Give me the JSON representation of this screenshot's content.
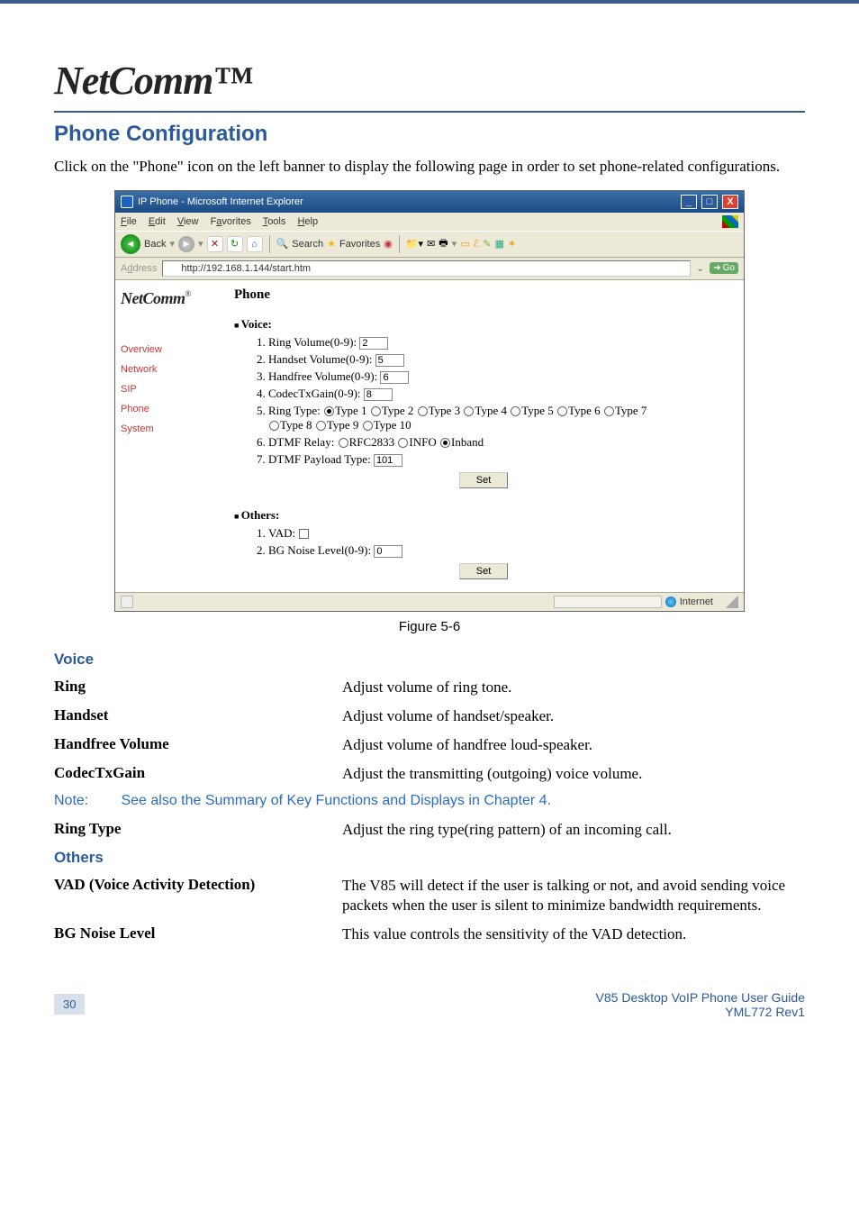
{
  "logo_text": "NetComm",
  "logo_tm": "™",
  "heading": "Phone Configuration",
  "intro": "Click on the \"Phone\" icon on the left banner to display the following page in order to set phone-related configurations.",
  "figure_caption": "Figure 5-6",
  "voice_heading": "Voice",
  "voice_items": [
    {
      "term": "Ring",
      "desc": "Adjust volume of ring tone."
    },
    {
      "term": "Handset",
      "desc": "Adjust volume of handset/speaker."
    },
    {
      "term": "Handfree Volume",
      "desc": "Adjust volume of handfree loud-speaker."
    },
    {
      "term": "CodecTxGain",
      "desc": "Adjust the transmitting (outgoing) voice volume."
    }
  ],
  "note_label": "Note:",
  "note_text": "See also the Summary of Key Functions and Displays in Chapter 4.",
  "ring_type": {
    "term": "Ring Type",
    "desc": "Adjust the ring type(ring pattern) of an incoming call."
  },
  "others_heading": "Others",
  "others_items": [
    {
      "term": "VAD (Voice Activity Detection)",
      "desc": "The V85 will detect if the user is talking or not, and avoid sending voice packets when the user is silent to minimize bandwidth requirements."
    },
    {
      "term": "BG Noise Level",
      "desc": "This value controls the sensitivity of the VAD detection."
    }
  ],
  "footer": {
    "page_num": "30",
    "line1": "V85 Desktop VoIP Phone User Guide",
    "line2": "YML772 Rev1"
  },
  "ie": {
    "title": "IP Phone - Microsoft Internet Explorer",
    "menu": {
      "file": "File",
      "edit": "Edit",
      "view": "View",
      "favorites": "Favorites",
      "tools": "Tools",
      "help": "Help"
    },
    "toolbar": {
      "back": "Back",
      "search": "Search",
      "favorites": "Favorites"
    },
    "address_label": "Address",
    "address_url": "http://192.168.1.144/start.htm",
    "go": "Go",
    "page_title": "Phone",
    "nc_logo": "NetComm",
    "nc_reg": "®",
    "nav": [
      "Overview",
      "Network",
      "SIP",
      "Phone",
      "System"
    ],
    "voice_label": "Voice:",
    "voice_fields": {
      "ring_volume_label": "Ring Volume(0-9):",
      "ring_volume_value": "2",
      "handset_volume_label": "Handset Volume(0-9):",
      "handset_volume_value": "5",
      "handfree_volume_label": "Handfree Volume(0-9):",
      "handfree_volume_value": "6",
      "codectxgain_label": "CodecTxGain(0-9):",
      "codectxgain_value": "8",
      "ring_type_label": "Ring Type:",
      "ring_types": [
        "Type 1",
        "Type 2",
        "Type 3",
        "Type 4",
        "Type 5",
        "Type 6",
        "Type 7",
        "Type 8",
        "Type 9",
        "Type 10"
      ],
      "dtmf_relay_label": "DTMF Relay:",
      "dtmf_relay_options": [
        "RFC2833",
        "INFO",
        "Inband"
      ],
      "dtmf_payload_label": "DTMF Payload Type:",
      "dtmf_payload_value": "101"
    },
    "others_label": "Others:",
    "others_fields": {
      "vad_label": "VAD:",
      "bg_noise_label": "BG Noise Level(0-9):",
      "bg_noise_value": "0"
    },
    "set_button": "Set",
    "status_zone": "Internet"
  }
}
